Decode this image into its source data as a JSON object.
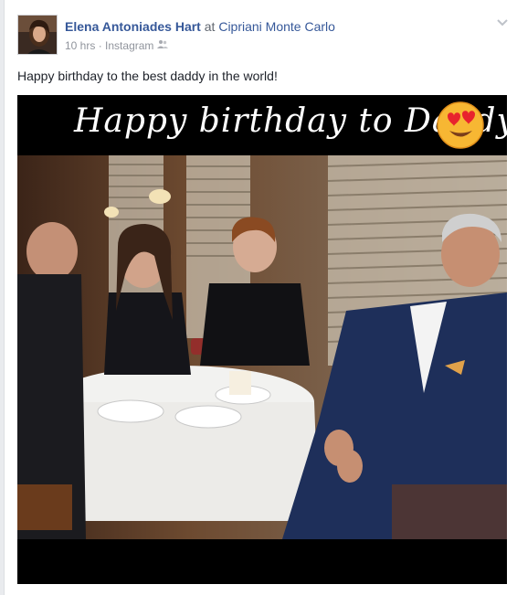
{
  "post": {
    "author_name": "Elena Antoniades Hart",
    "at_word": "at",
    "place": "Cipriani Monte Carlo",
    "time": "10 hrs",
    "separator": "·",
    "source": "Instagram",
    "audience_icon": "friends-icon",
    "text": "Happy birthday to the best daddy in the world!",
    "photo_caption": "Happy birthday to Daddy !",
    "photo_emoji_icon": "heart-eyes-emoji-icon"
  }
}
